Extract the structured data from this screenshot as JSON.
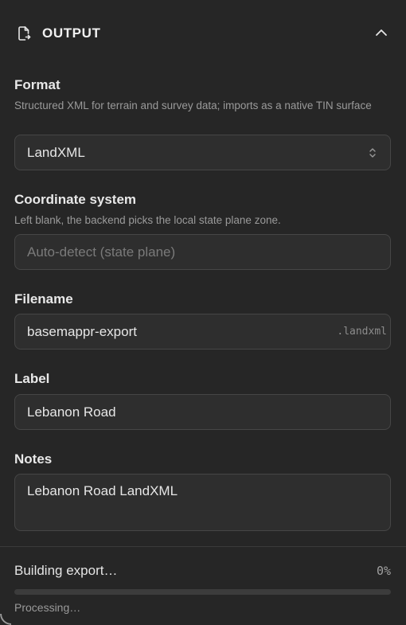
{
  "header": {
    "title": "OUTPUT",
    "icon": "file-export-icon",
    "collapse_icon": "chevron-up-icon"
  },
  "format": {
    "label": "Format",
    "description": "Structured XML for terrain and survey data; imports as a native TIN surface",
    "value": "LandXML"
  },
  "coordinate_system": {
    "label": "Coordinate system",
    "description": "Left blank, the backend picks the local state plane zone.",
    "value": "",
    "placeholder": "Auto-detect (state plane)"
  },
  "filename": {
    "label": "Filename",
    "value": "basemappr-export",
    "suffix": ".landxml"
  },
  "label_field": {
    "label": "Label",
    "value": "Lebanon Road"
  },
  "notes": {
    "label": "Notes",
    "value": "Lebanon Road LandXML"
  },
  "progress": {
    "label": "Building export…",
    "percent_text": "0%",
    "fraction": 0,
    "status": "Processing…",
    "fill_color": "#6b8afd"
  }
}
